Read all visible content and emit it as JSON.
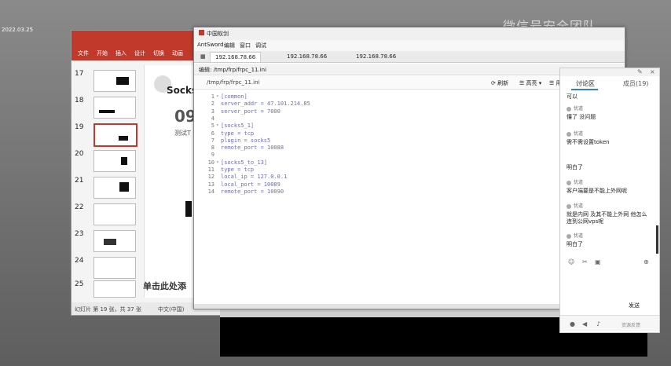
{
  "desktop": {
    "icon_label": "2022.03.25",
    "watermark": "微信号安全团队"
  },
  "ppt": {
    "ribbon_tabs": [
      "文件",
      "开始",
      "插入",
      "设计",
      "切换",
      "动画"
    ],
    "slide_numbers": [
      "17",
      "18",
      "19",
      "20",
      "21",
      "22",
      "23",
      "24",
      "25"
    ],
    "slide_heading": "Socks",
    "slide_big": "09",
    "slide_small": "测试T",
    "placeholder": "单击此处添",
    "status_page": "幻灯片 第 19 张，共 37 张",
    "status_lang": "中文(中国)"
  },
  "antsword": {
    "title": "中国蚁剑",
    "menu": [
      "AntSword",
      "编辑",
      "窗口",
      "调试"
    ],
    "tabs": [
      "192.168.78.66",
      "192.168.78.66",
      "192.168.78.66"
    ],
    "editor_title": "编辑: /tmp/frp/frpc_11.ini",
    "path": "/tmp/frp/frpc_11.ini",
    "refresh_label": "刷新",
    "highlight_label": "高亮",
    "extra_label": "用",
    "code_lines": [
      {
        "n": "1",
        "text": "[common]"
      },
      {
        "n": "2",
        "text": "server_addr = 47.101.214.85"
      },
      {
        "n": "3",
        "text": "server_port = 7000"
      },
      {
        "n": "4",
        "text": ""
      },
      {
        "n": "5",
        "text": "[socks5_1]"
      },
      {
        "n": "6",
        "text": "type = tcp"
      },
      {
        "n": "7",
        "text": "plugin = socks5"
      },
      {
        "n": "8",
        "text": "remote_port = 10088"
      },
      {
        "n": "9",
        "text": ""
      },
      {
        "n": "10",
        "text": "[socks5_to_13]"
      },
      {
        "n": "11",
        "text": "type = tcp"
      },
      {
        "n": "12",
        "text": "local_ip = 127.0.0.1"
      },
      {
        "n": "13",
        "text": "local_port = 10089"
      },
      {
        "n": "14",
        "text": "remote_port = 10090"
      }
    ]
  },
  "chat": {
    "tab_discussion": "讨论区",
    "tab_members": "成员(19)",
    "messages": [
      {
        "user": "",
        "text": "可以"
      },
      {
        "user": "忧道",
        "text": "懂了 没问题"
      },
      {
        "user": "忧道",
        "text": "需不需设置token"
      },
      {
        "user": "",
        "text": "明白了"
      },
      {
        "user": "忧道",
        "text": "客户端要是不能上外网呢"
      },
      {
        "user": "忧道",
        "text": "就是内网 及其不能上外网 他怎么连到公网vps呢"
      },
      {
        "user": "忧道",
        "text": "明白了"
      }
    ],
    "send_label": "发送",
    "footer_text": "资源反馈"
  }
}
